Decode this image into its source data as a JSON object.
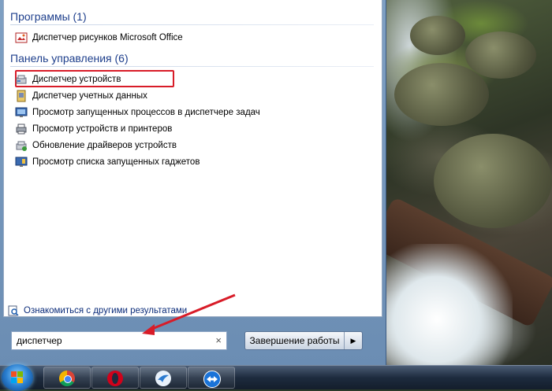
{
  "search_results": {
    "groups": [
      {
        "header": "Программы (1)",
        "items": [
          {
            "label": "Диспетчер рисунков Microsoft Office",
            "icon": "picture-manager-icon"
          }
        ]
      },
      {
        "header": "Панель управления (6)",
        "items": [
          {
            "label": "Диспетчер устройств",
            "icon": "device-manager-icon"
          },
          {
            "label": "Диспетчер учетных данных",
            "icon": "credential-manager-icon"
          },
          {
            "label": "Просмотр запущенных процессов в диспетчере задач",
            "icon": "task-manager-icon"
          },
          {
            "label": "Просмотр устройств и принтеров",
            "icon": "devices-printers-icon"
          },
          {
            "label": "Обновление драйверов устройств",
            "icon": "driver-update-icon"
          },
          {
            "label": "Просмотр списка запущенных гаджетов",
            "icon": "gadgets-icon"
          }
        ]
      }
    ],
    "see_more": "Ознакомиться с другими результатами"
  },
  "search": {
    "value": "диспетчер",
    "clear_glyph": "×"
  },
  "shutdown": {
    "label": "Завершение работы",
    "arrow_glyph": "▶"
  },
  "taskbar": {
    "apps": [
      {
        "name": "chrome",
        "icon": "chrome-icon"
      },
      {
        "name": "opera",
        "icon": "opera-icon"
      },
      {
        "name": "browser",
        "icon": "swift-browser-icon"
      },
      {
        "name": "teamviewer",
        "icon": "teamviewer-icon"
      }
    ]
  },
  "colors": {
    "group_header": "#1e3f8c",
    "highlight": "#d81c28",
    "annotation_arrow": "#d81c28"
  }
}
